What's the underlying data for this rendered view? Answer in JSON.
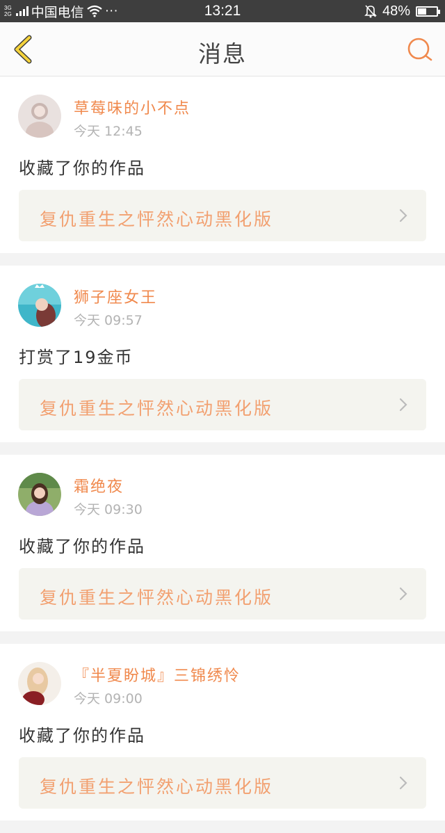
{
  "status_bar": {
    "network_top": "3G",
    "network_bottom": "2G",
    "carrier": "中国电信",
    "more": "···",
    "time": "13:21",
    "battery_percent": "48%",
    "battery_level": 0.48
  },
  "nav": {
    "title": "消息",
    "back_icon": "chevron-left-icon",
    "search_icon": "search-icon",
    "accent_color": "#f0894d"
  },
  "messages": [
    {
      "username": "草莓味的小不点",
      "time": "今天 12:45",
      "action": "收藏了你的作品",
      "work_title": "复仇重生之怦然心动黑化版"
    },
    {
      "username": "狮子座女王",
      "time": "今天 09:57",
      "action": "打赏了19金币",
      "work_title": "复仇重生之怦然心动黑化版"
    },
    {
      "username": "霜绝夜",
      "time": "今天 09:30",
      "action": "收藏了你的作品",
      "work_title": "复仇重生之怦然心动黑化版"
    },
    {
      "username": "『半夏盼城』三锦绣怜",
      "time": "今天 09:00",
      "action": "收藏了你的作品",
      "work_title": "复仇重生之怦然心动黑化版"
    }
  ]
}
